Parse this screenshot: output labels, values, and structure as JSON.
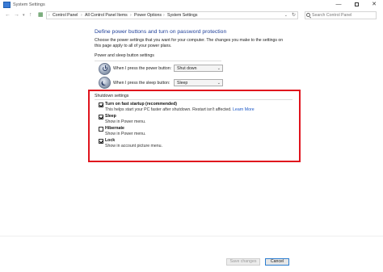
{
  "window": {
    "title": "System Settings"
  },
  "address": {
    "crumbs": [
      "Control Panel",
      "All Control Panel Items",
      "Power Options",
      "System Settings"
    ],
    "search_placeholder": "Search Control Panel"
  },
  "main": {
    "heading": "Define power buttons and turn on password protection",
    "description": "Choose the power settings that you want for your computer. The changes you make to the settings on this page apply to all of your power plans.",
    "power_section_label": "Power and sleep button settings",
    "power_button_label": "When I press the power button:",
    "power_button_value": "Shut down",
    "sleep_button_label": "When I press the sleep button:",
    "sleep_button_value": "Sleep",
    "shutdown_section_label": "Shutdown settings",
    "options": [
      {
        "label": "Turn on fast startup (recommended)",
        "sub": "This helps start your PC faster after shutdown. Restart isn't affected.",
        "link": "Learn More",
        "checked": true
      },
      {
        "label": "Sleep",
        "sub": "Show in Power menu.",
        "checked": true
      },
      {
        "label": "Hibernate",
        "sub": "Show in Power menu.",
        "checked": false
      },
      {
        "label": "Lock",
        "sub": "Show in account picture menu.",
        "checked": true
      }
    ]
  },
  "footer": {
    "save_label": "Save changes",
    "cancel_label": "Cancel"
  },
  "colors": {
    "heading": "#1e3f99",
    "highlight": "#e0141d",
    "link": "#1a56c5"
  }
}
